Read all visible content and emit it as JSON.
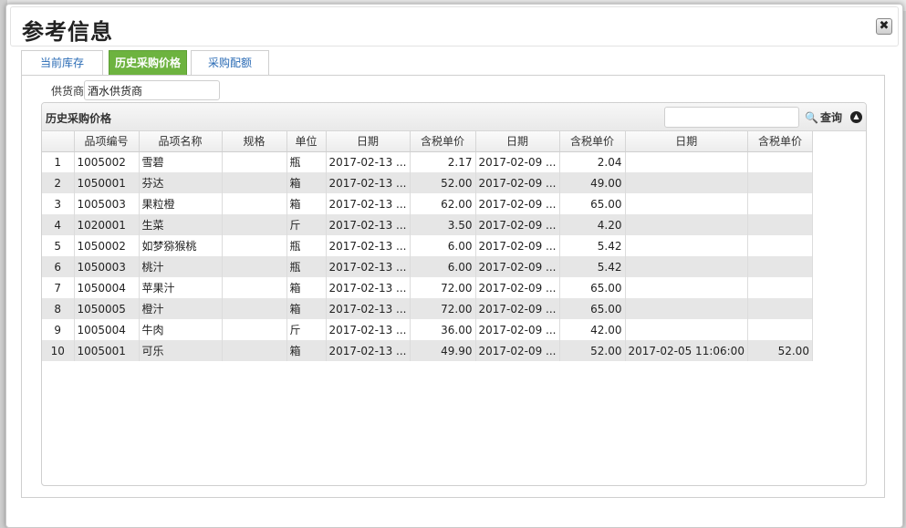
{
  "dialog": {
    "title": "参考信息",
    "close_label": "✖"
  },
  "tabs": [
    {
      "label": "当前库存",
      "active": false
    },
    {
      "label": "历史采购价格",
      "active": true
    },
    {
      "label": "采购配额",
      "active": false
    }
  ],
  "supplier": {
    "label": "供货商",
    "value": "酒水供货商"
  },
  "grid": {
    "title": "历史采购价格",
    "search_placeholder": "",
    "search_label": "查询",
    "search_icon": "magnifier-icon",
    "collapse_icon": "chevron-up-icon",
    "columns": [
      "",
      "品项编号",
      "品项名称",
      "规格",
      "单位",
      "日期",
      "含税单价",
      "日期",
      "含税单价",
      "日期",
      "含税单价"
    ],
    "rows": [
      [
        "1",
        "1005002",
        "雪碧",
        "",
        "瓶",
        "2017-02-13 ...",
        "2.17",
        "2017-02-09 ...",
        "2.04",
        "",
        ""
      ],
      [
        "2",
        "1050001",
        "芬达",
        "",
        "箱",
        "2017-02-13 ...",
        "52.00",
        "2017-02-09 ...",
        "49.00",
        "",
        ""
      ],
      [
        "3",
        "1005003",
        "果粒橙",
        "",
        "箱",
        "2017-02-13 ...",
        "62.00",
        "2017-02-09 ...",
        "65.00",
        "",
        ""
      ],
      [
        "4",
        "1020001",
        "生菜",
        "",
        "斤",
        "2017-02-13 ...",
        "3.50",
        "2017-02-09 ...",
        "4.20",
        "",
        ""
      ],
      [
        "5",
        "1050002",
        "如梦猕猴桃",
        "",
        "瓶",
        "2017-02-13 ...",
        "6.00",
        "2017-02-09 ...",
        "5.42",
        "",
        ""
      ],
      [
        "6",
        "1050003",
        "桃汁",
        "",
        "瓶",
        "2017-02-13 ...",
        "6.00",
        "2017-02-09 ...",
        "5.42",
        "",
        ""
      ],
      [
        "7",
        "1050004",
        "苹果汁",
        "",
        "箱",
        "2017-02-13 ...",
        "72.00",
        "2017-02-09 ...",
        "65.00",
        "",
        ""
      ],
      [
        "8",
        "1050005",
        "橙汁",
        "",
        "箱",
        "2017-02-13 ...",
        "72.00",
        "2017-02-09 ...",
        "65.00",
        "",
        ""
      ],
      [
        "9",
        "1005004",
        "牛肉",
        "",
        "斤",
        "2017-02-13 ...",
        "36.00",
        "2017-02-09 ...",
        "42.00",
        "",
        ""
      ],
      [
        "10",
        "1005001",
        "可乐",
        "",
        "箱",
        "2017-02-13 ...",
        "49.90",
        "2017-02-09 ...",
        "52.00",
        "2017-02-05 11:06:00",
        "52.00"
      ]
    ]
  }
}
